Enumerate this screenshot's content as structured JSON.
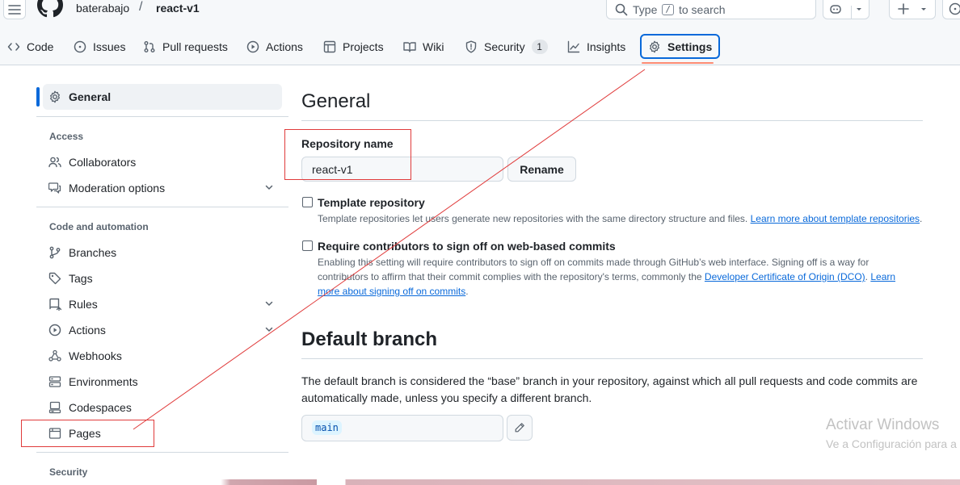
{
  "header": {
    "owner": "baterabajo",
    "separator": "/",
    "repo": "react-v1",
    "search": {
      "prefix": "Type",
      "key": "/",
      "suffix": "to search"
    }
  },
  "tabs": [
    {
      "label": "Code",
      "icon": "code-icon"
    },
    {
      "label": "Issues",
      "icon": "issue-opened-icon"
    },
    {
      "label": "Pull requests",
      "icon": "git-pull-request-icon"
    },
    {
      "label": "Actions",
      "icon": "play-icon"
    },
    {
      "label": "Projects",
      "icon": "table-icon"
    },
    {
      "label": "Wiki",
      "icon": "book-icon"
    },
    {
      "label": "Security",
      "icon": "shield-icon",
      "counter": "1"
    },
    {
      "label": "Insights",
      "icon": "graph-icon"
    },
    {
      "label": "Settings",
      "icon": "gear-icon",
      "selected": true
    }
  ],
  "sidebar": {
    "general": "General",
    "access_heading": "Access",
    "access_items": [
      "Collaborators",
      "Moderation options"
    ],
    "code_heading": "Code and automation",
    "code_items": [
      "Branches",
      "Tags",
      "Rules",
      "Actions",
      "Webhooks",
      "Environments",
      "Codespaces",
      "Pages"
    ],
    "security_heading": "Security"
  },
  "main": {
    "title": "General",
    "repo_name_label": "Repository name",
    "repo_name_value": "react-v1",
    "rename_button": "Rename",
    "template": {
      "label": "Template repository",
      "desc": "Template repositories let users generate new repositories with the same directory structure and files.",
      "link": "Learn more about template repositories",
      "end": "."
    },
    "signoff": {
      "label": "Require contributors to sign off on web-based commits",
      "desc_line1": "Enabling this setting will require contributors to sign off on commits made through GitHub’s web interface. Signing off is a way for",
      "desc_line2": "contributors to affirm that their commit complies with the repository's terms, commonly the",
      "link1": "Developer Certificate of Origin (DCO)",
      "mid": ".",
      "link2_part1": "Learn",
      "link2_part2": "more about signing off on commits",
      "end": "."
    },
    "branch_title": "Default branch",
    "branch_desc": "The default branch is considered the “base” branch in your repository, against which all pull requests and code commits are automatically made, unless you specify a different branch.",
    "branch_name": "main"
  },
  "watermark": {
    "line1": "Activar Windows",
    "line2": "Ve a Configuración para a"
  },
  "colors": {
    "accent": "#0969da",
    "tab_underline": "#fd8c73",
    "annotation": "#e03b3b"
  }
}
